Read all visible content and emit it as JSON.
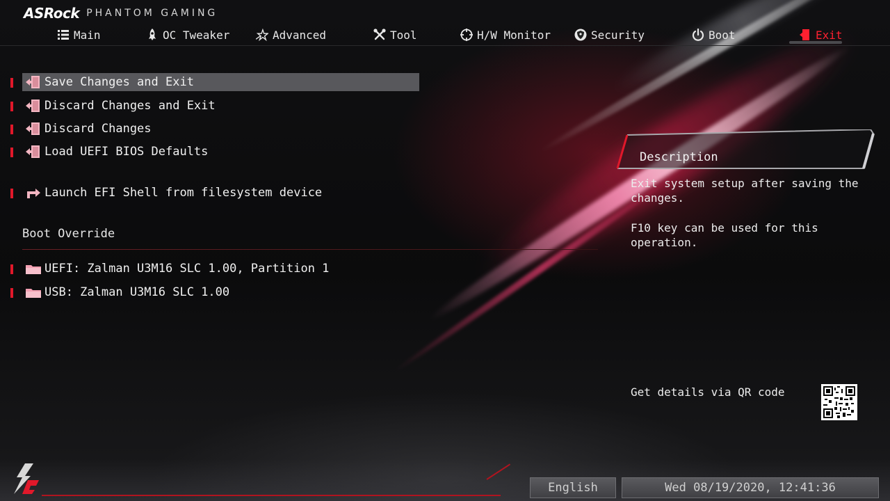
{
  "header": {
    "brand": "ASRock",
    "subtitle": "PHANTOM GAMING"
  },
  "nav": {
    "tabs": [
      {
        "label": "Main",
        "icon": "list-icon"
      },
      {
        "label": "OC Tweaker",
        "icon": "rocket-icon"
      },
      {
        "label": "Advanced",
        "icon": "star-icon"
      },
      {
        "label": "Tool",
        "icon": "tools-icon"
      },
      {
        "label": "H/W Monitor",
        "icon": "crosshair-icon"
      },
      {
        "label": "Security",
        "icon": "shield-icon"
      },
      {
        "label": "Boot",
        "icon": "power-icon"
      },
      {
        "label": "Exit",
        "icon": "exit-door-icon"
      }
    ],
    "active_tab": "Exit"
  },
  "menu": {
    "items": [
      {
        "label": "Save Changes and Exit",
        "icon": "exit-door-icon",
        "selected": true
      },
      {
        "label": "Discard Changes and Exit",
        "icon": "exit-door-icon"
      },
      {
        "label": "Discard Changes",
        "icon": "exit-door-icon"
      },
      {
        "label": "Load UEFI BIOS Defaults",
        "icon": "exit-door-icon"
      },
      {
        "label": "Launch EFI Shell from filesystem device",
        "icon": "launch-arrow-icon"
      }
    ],
    "boot_override": {
      "title": "Boot Override",
      "items": [
        {
          "label": "UEFI: Zalman U3M16 SLC 1.00, Partition 1",
          "icon": "folder-icon"
        },
        {
          "label": "USB: Zalman U3M16 SLC 1.00",
          "icon": "folder-icon"
        }
      ]
    }
  },
  "description": {
    "title": "Description",
    "line1": "Exit system setup after saving the changes.",
    "line2": "F10 key can be used for this operation."
  },
  "qr": {
    "label": "Get details via QR code"
  },
  "footer": {
    "language": "English",
    "datetime": "Wed 08/19/2020, 12:41:36"
  },
  "colors": {
    "accent": "#e0182a",
    "active_tab": "#ff2030",
    "highlight_row": "#58585c",
    "icon_pink": "#f3b6c2"
  }
}
